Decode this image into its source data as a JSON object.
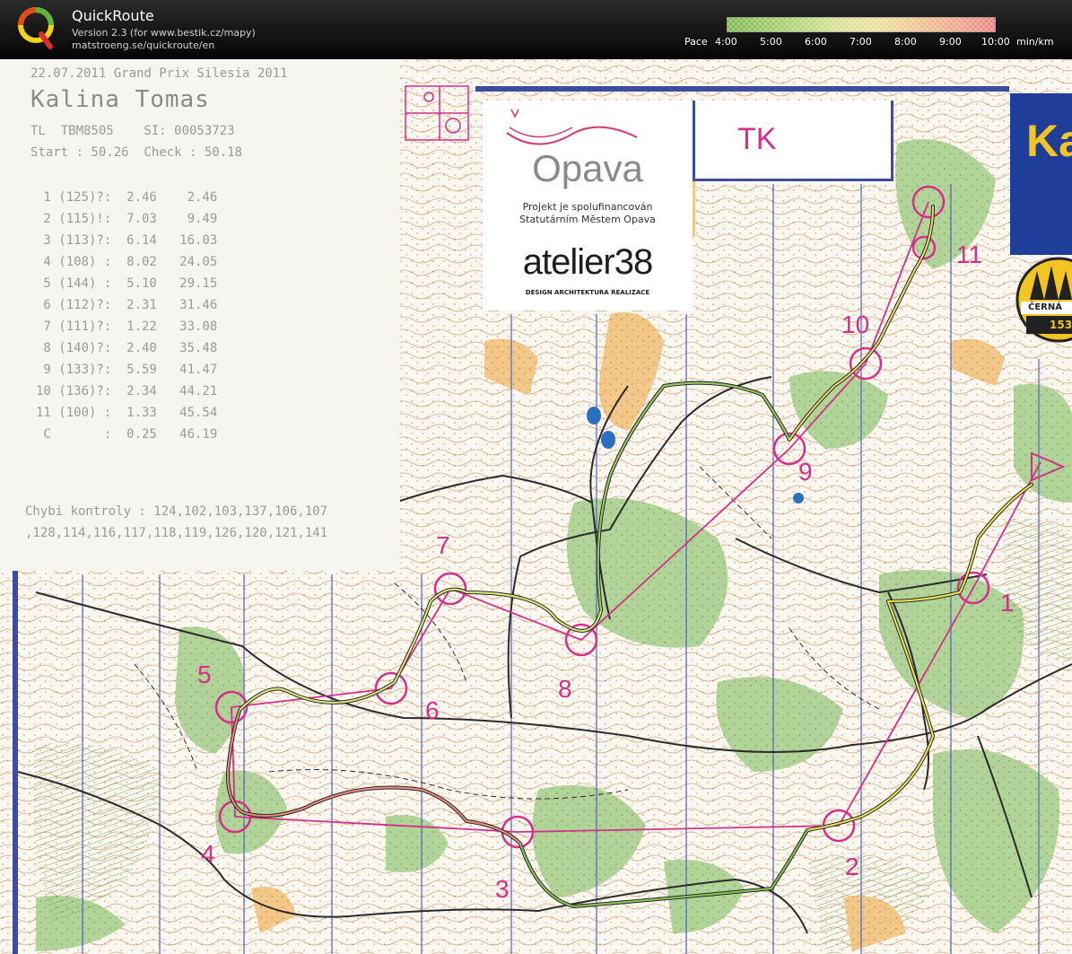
{
  "app": {
    "name": "QuickRoute",
    "version": "Version 2.3  (for www.bestik.cz/mapy)",
    "url": "matstroeng.se/quickroute/en",
    "logo_icon": "quickroute-logo-icon"
  },
  "pace_scale": {
    "label": "Pace",
    "ticks": [
      "4:00",
      "5:00",
      "6:00",
      "7:00",
      "8:00",
      "9:00",
      "10:00"
    ],
    "unit": "min/km",
    "colors": [
      "#7fb852",
      "#a7cf70",
      "#cfe08c",
      "#e8e59a",
      "#eecf96",
      "#eeb090",
      "#e98c86"
    ]
  },
  "receipt": {
    "header": "22.07.2011 Grand Prix Silesia 2011",
    "name": "Kalina Tomas",
    "id_line": "TL  TBM8505    SI: 00053723",
    "start_line": "Start : 50.26  Check : 50.18",
    "splits": [
      " 1 (125)?:  2.46    2.46",
      " 2 (115)!:  7.03    9.49",
      " 3 (113)?:  6.14   16.03",
      " 4 (108) :  8.02   24.05",
      " 5 (144) :  5.10   29.15",
      " 6 (112)?:  2.31   31.46",
      " 7 (111)?:  1.22   33.08",
      " 8 (140)?:  2.40   35.48",
      " 9 (133)?:  5.59   41.47",
      "10 (136)?:  2.34   44.21",
      "11 (100) :  1.33   45.54",
      " C       :  0.25   46.19"
    ],
    "missing_1": "Chybi kontroly : 124,102,103,137,106,107",
    "missing_2": ",128,114,116,117,118,119,126,120,121,141"
  },
  "ad": {
    "city": "Opava",
    "line1": "Projekt je spolufinancován",
    "line2": "Statutárním Městem Opava",
    "company": "atelier38",
    "tagline": "DESIGN  ARCHITEKTURA  REALIZACE"
  },
  "map_labels": {
    "tk": "TK",
    "banner": "Ka",
    "seal_1": "ČERNÁ",
    "seal_2": "153"
  },
  "controls": [
    "1",
    "2",
    "3",
    "4",
    "5",
    "6",
    "7",
    "8",
    "9",
    "10",
    "11"
  ]
}
